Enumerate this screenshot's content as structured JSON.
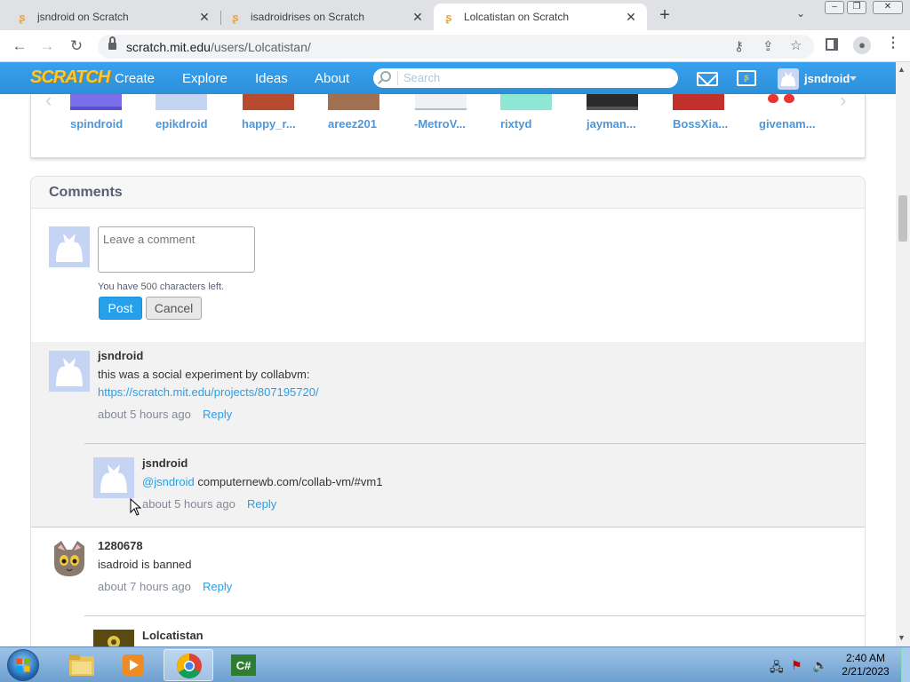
{
  "browser": {
    "tabs": [
      {
        "title": "jsndroid on Scratch",
        "favicon": "scratch-favicon",
        "active": false
      },
      {
        "title": "isadroidrises on Scratch",
        "favicon": "scratch-favicon",
        "active": false
      },
      {
        "title": "Lolcatistan on Scratch",
        "favicon": "scratch-favicon",
        "active": true
      }
    ],
    "new_tab_glyph": "+",
    "url_host": "scratch.mit.edu",
    "url_path": "/users/Lolcatistan/"
  },
  "scratch_nav": {
    "logo": "SCRATCH",
    "links": [
      "Create",
      "Explore",
      "Ideas",
      "About"
    ],
    "search_placeholder": "Search",
    "username": "jsndroid"
  },
  "following": {
    "users": [
      "spindroid",
      "epikdroid",
      "happy_r...",
      "areez201",
      "-MetroV...",
      "rixtyd",
      "jayman...",
      "BossXia...",
      "givenam..."
    ]
  },
  "comments": {
    "heading": "Comments",
    "input_placeholder": "Leave a comment",
    "chars_left": "You have 500 characters left.",
    "post_label": "Post",
    "cancel_label": "Cancel",
    "items": [
      {
        "user": "jsndroid",
        "text": "this was a social experiment by collabvm:",
        "link": "https://scratch.mit.edu/projects/807195720/",
        "time": "about 5 hours ago",
        "reply": "Reply",
        "replies": [
          {
            "user": "jsndroid",
            "mention": "@jsndroid",
            "text": " computernewb.com/collab-vm/#vm1",
            "time": "about 5 hours ago",
            "reply": "Reply"
          }
        ]
      },
      {
        "user": "1280678",
        "text": "isadroid is banned",
        "time": "about 7 hours ago",
        "reply": "Reply",
        "replies": [
          {
            "user": "Lolcatistan"
          }
        ]
      }
    ]
  },
  "taskbar": {
    "clock_time": "2:40 AM",
    "clock_date": "2/21/2023"
  }
}
